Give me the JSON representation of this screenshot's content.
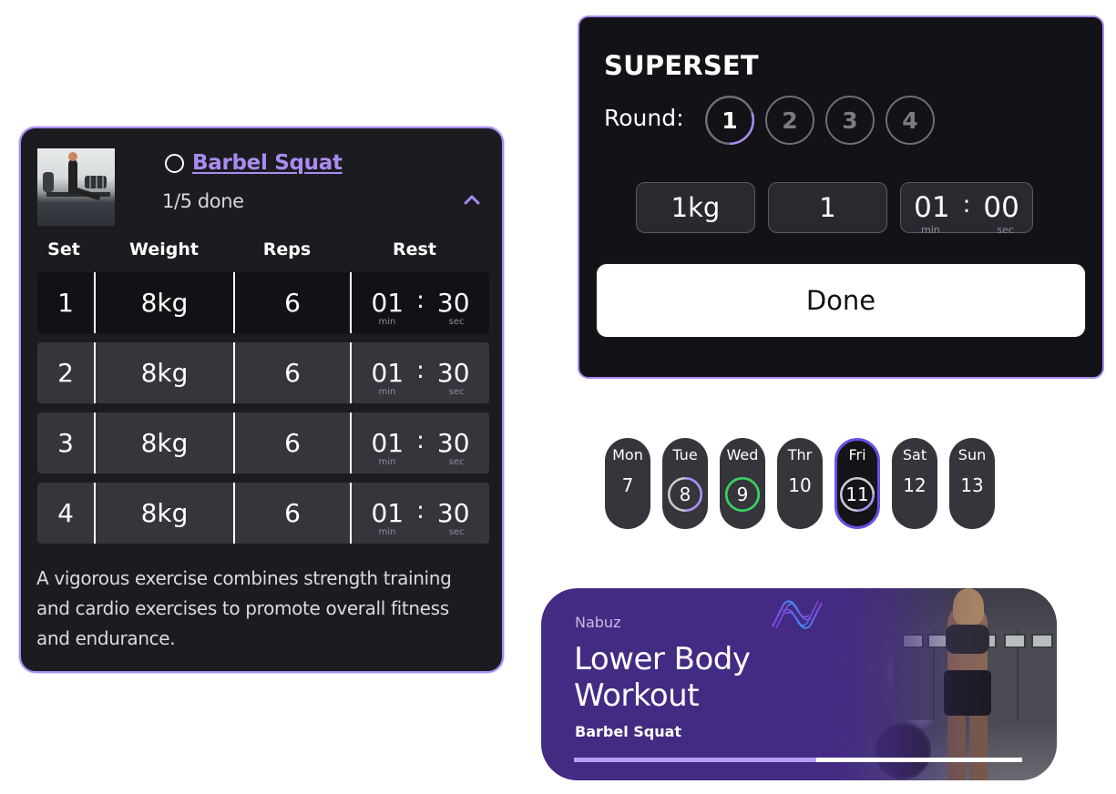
{
  "exercise_card": {
    "title": "Barbel Squat",
    "progress": "1/5 done",
    "completed": false,
    "expanded": true,
    "columns": [
      "Set",
      "Weight",
      "Reps",
      "Rest"
    ],
    "sets": [
      {
        "set": "1",
        "weight": "8kg",
        "reps": "6",
        "rest_min": "01",
        "rest_sec": "30",
        "active": true
      },
      {
        "set": "2",
        "weight": "8kg",
        "reps": "6",
        "rest_min": "01",
        "rest_sec": "30",
        "active": false
      },
      {
        "set": "3",
        "weight": "8kg",
        "reps": "6",
        "rest_min": "01",
        "rest_sec": "30",
        "active": false
      },
      {
        "set": "4",
        "weight": "8kg",
        "reps": "6",
        "rest_min": "01",
        "rest_sec": "30",
        "active": false
      }
    ],
    "time_labels": {
      "min": "min",
      "sec": "sec",
      "separator": ":"
    },
    "description": "A vigorous exercise combines strength training and cardio exercises to promote overall fitness and endurance."
  },
  "superset": {
    "title": "SUPERSET",
    "round_label": "Round:",
    "rounds": [
      "1",
      "2",
      "3",
      "4"
    ],
    "current_round": "1",
    "current_round_progress": 0.3,
    "weight": "1kg",
    "reps": "1",
    "rest_min": "01",
    "rest_sec": "00",
    "done_label": "Done"
  },
  "week": {
    "days": [
      {
        "name": "Mon",
        "date": "7",
        "ring": "none",
        "progress": 0
      },
      {
        "name": "Tue",
        "date": "8",
        "ring": "partial",
        "progress": 0.5
      },
      {
        "name": "Wed",
        "date": "9",
        "ring": "complete",
        "progress": 1.0
      },
      {
        "name": "Thr",
        "date": "10",
        "ring": "none",
        "progress": 0
      },
      {
        "name": "Fri",
        "date": "11",
        "ring": "partial",
        "progress": 0.25,
        "selected": true
      },
      {
        "name": "Sat",
        "date": "12",
        "ring": "none",
        "progress": 0
      },
      {
        "name": "Sun",
        "date": "13",
        "ring": "none",
        "progress": 0
      }
    ]
  },
  "banner": {
    "brand": "Nabuz",
    "title": "Lower Body Workout",
    "subtitle": "Barbel Squat",
    "progress": 0.54
  },
  "colors": {
    "accent": "#a98cf0",
    "accent_deep": "#6a4ee8",
    "success": "#2fd35a",
    "card_bg": "#1c1b20",
    "banner_bg": "#432b83"
  }
}
